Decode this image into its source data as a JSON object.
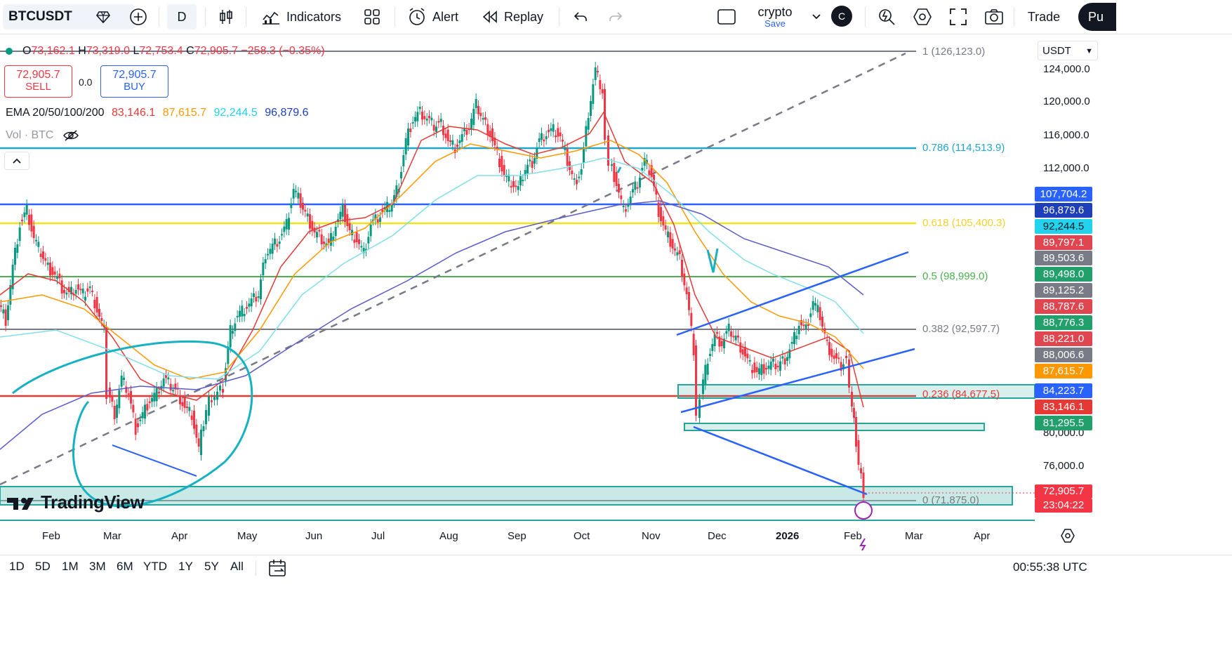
{
  "toolbar": {
    "symbol": "BTCUSDT",
    "interval": "D",
    "indicators_label": "Indicators",
    "alert_label": "Alert",
    "replay_label": "Replay",
    "layout_name": "crypto",
    "layout_save": "Save",
    "avatar_letter": "C",
    "trade_label": "Trade",
    "publish_label": "Pu"
  },
  "legend": {
    "o_key": "O",
    "o_val": "73,162.1",
    "h_key": "H",
    "h_val": "73,319.0",
    "l_key": "L",
    "l_val": "72,753.4",
    "c_key": "C",
    "c_val": "72,905.7",
    "change": "−258.3 (−0.35%)",
    "sell_price": "72,905.7",
    "sell_label": "SELL",
    "spread": "0.0",
    "buy_price": "72,905.7",
    "buy_label": "BUY",
    "ema_name": "EMA 20/50/100/200",
    "ema20": "83,146.1",
    "ema50": "87,615.7",
    "ema100": "92,244.5",
    "ema200": "96,879.6",
    "vol_label": "Vol · BTC",
    "collapse_icon": "chevron-up-icon"
  },
  "currency": "USDT",
  "price_axis": [
    "124,000.0",
    "120,000.0",
    "116,000.0",
    "112,000.0",
    "80,000.0",
    "76,000.0"
  ],
  "time_axis": [
    "Feb",
    "Mar",
    "Apr",
    "May",
    "Jun",
    "Jul",
    "Aug",
    "Sep",
    "Oct",
    "Nov",
    "Dec",
    "2026",
    "Feb",
    "Mar",
    "Apr"
  ],
  "fib_labels": {
    "f1": "1 (126,123.0)",
    "f786": "0.786 (114,513.9)",
    "f618": "0.618 (105,400.3)",
    "f5": "0.5 (98,999.0)",
    "f382": "0.382 (92,597.7)",
    "f236": "0.236 (84,677.5)",
    "f0": "0 (71,875.0)"
  },
  "price_tags": [
    {
      "text": "107,704.2",
      "color": "#2962ff"
    },
    {
      "text": "96,879.6",
      "color": "#1e3fb8"
    },
    {
      "text": "92,244.5",
      "color": "#22d3ee"
    },
    {
      "text": "89,797.1",
      "color": "#e04650"
    },
    {
      "text": "89,503.6",
      "color": "#787b86"
    },
    {
      "text": "89,498.0",
      "color": "#22a06b"
    },
    {
      "text": "89,125.2",
      "color": "#787b86"
    },
    {
      "text": "88,787.6",
      "color": "#e04650"
    },
    {
      "text": "88,776.3",
      "color": "#22a06b"
    },
    {
      "text": "88,221.0",
      "color": "#e04650"
    },
    {
      "text": "88,006.6",
      "color": "#787b86"
    },
    {
      "text": "87,615.7",
      "color": "#ff9800"
    },
    {
      "text": "84,223.7",
      "color": "#2962ff"
    },
    {
      "text": "83,146.1",
      "color": "#e53935"
    },
    {
      "text": "81,295.5",
      "color": "#22a06b"
    }
  ],
  "last_price": "72,905.7",
  "countdown": "23:04:22",
  "ranges": [
    "1D",
    "5D",
    "1M",
    "3M",
    "6M",
    "YTD",
    "1Y",
    "5Y",
    "All"
  ],
  "clock": "00:55:38 UTC",
  "watermark": "TradingView",
  "colors": {
    "up": "#089981",
    "down": "#f23645",
    "ema20": "#e53935",
    "ema50": "#ff9800",
    "ema100": "#80deea",
    "ema200": "#5c5cc8",
    "trend": "#2962ff",
    "draw": "#16b1c2"
  }
}
